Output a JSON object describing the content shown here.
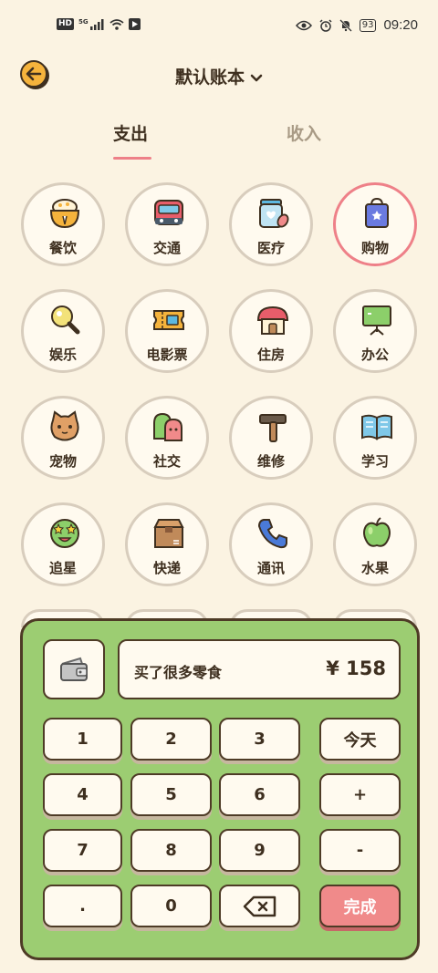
{
  "status_bar": {
    "hd": "HD",
    "signal": "5G",
    "battery": "93",
    "time": "09:20"
  },
  "header": {
    "title": "默认账本"
  },
  "tabs": [
    {
      "label": "支出"
    },
    {
      "label": "收入"
    }
  ],
  "categories": [
    {
      "label": "餐饮",
      "icon": "rice-bowl-icon"
    },
    {
      "label": "交通",
      "icon": "bus-icon"
    },
    {
      "label": "医疗",
      "icon": "medicine-jar-icon"
    },
    {
      "label": "购物",
      "icon": "shopping-bag-icon"
    },
    {
      "label": "娱乐",
      "icon": "magnifier-icon"
    },
    {
      "label": "电影票",
      "icon": "ticket-icon"
    },
    {
      "label": "住房",
      "icon": "house-icon"
    },
    {
      "label": "办公",
      "icon": "presentation-board-icon"
    },
    {
      "label": "宠物",
      "icon": "cat-icon"
    },
    {
      "label": "社交",
      "icon": "friends-icon"
    },
    {
      "label": "维修",
      "icon": "hammer-icon"
    },
    {
      "label": "学习",
      "icon": "open-book-icon"
    },
    {
      "label": "追星",
      "icon": "star-face-icon"
    },
    {
      "label": "快递",
      "icon": "parcel-box-icon"
    },
    {
      "label": "通讯",
      "icon": "phone-icon"
    },
    {
      "label": "水果",
      "icon": "apple-icon"
    }
  ],
  "selected_category": "购物",
  "entry": {
    "note": "买了很多零食",
    "amount": "¥ 158"
  },
  "keypad": {
    "keys": [
      "1",
      "2",
      "3",
      "今天",
      "4",
      "5",
      "6",
      "+",
      "7",
      "8",
      "9",
      "-",
      ".",
      "0"
    ],
    "done_label": "完成"
  },
  "colors": {
    "background": "#fbf3e2",
    "keypad_bg": "#9ccd72",
    "accent_pink": "#ee8088",
    "back_button": "#f5b33c",
    "ink": "#3e2f1f"
  }
}
